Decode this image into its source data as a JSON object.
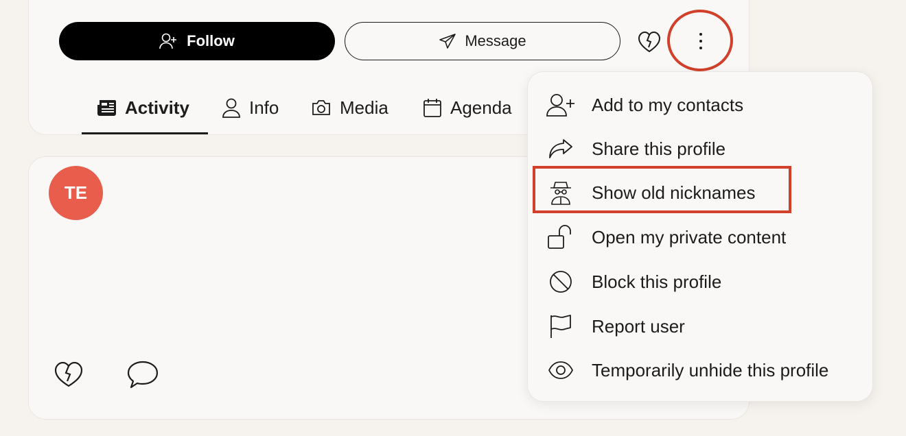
{
  "profile": {
    "follow_label": "Follow",
    "message_label": "Message"
  },
  "tabs": [
    {
      "label": "Activity",
      "icon": "newspaper-icon"
    },
    {
      "label": "Info",
      "icon": "user-icon"
    },
    {
      "label": "Media",
      "icon": "camera-icon"
    },
    {
      "label": "Agenda",
      "icon": "calendar-icon"
    }
  ],
  "post": {
    "avatar_initials": "TE"
  },
  "menu": {
    "items": [
      {
        "label": "Add to my contacts",
        "icon": "user-plus-icon"
      },
      {
        "label": "Share this profile",
        "icon": "share-icon"
      },
      {
        "label": "Show old nicknames",
        "icon": "spy-icon"
      },
      {
        "label": "Open my private content",
        "icon": "unlock-icon"
      },
      {
        "label": "Block this profile",
        "icon": "block-icon"
      },
      {
        "label": "Report user",
        "icon": "flag-icon"
      },
      {
        "label": "Temporarily unhide this profile",
        "icon": "eye-icon"
      }
    ]
  },
  "colors": {
    "background": "#f6f3ef",
    "card": "#faf8f6",
    "avatar": "#e85d4c",
    "highlight": "#d1402a",
    "primary_button": "#000000"
  }
}
